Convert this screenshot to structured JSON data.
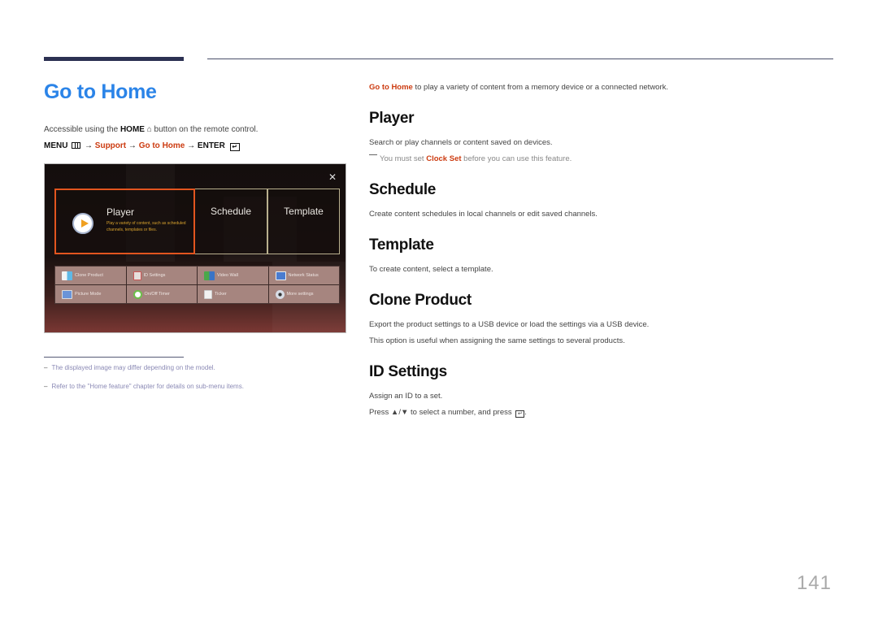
{
  "header": {
    "title": "Go to Home"
  },
  "left": {
    "access_prefix": "Accessible using the ",
    "access_key": "HOME",
    "access_icon": "home-icon",
    "access_suffix": " button on the remote control.",
    "menu_path": {
      "menu": "MENU",
      "arrow": "→",
      "support": "Support",
      "go_to_home": "Go to Home",
      "enter": "ENTER",
      "enter_glyph": "↵"
    },
    "tv_ui": {
      "close_glyph": "✕",
      "tiles": [
        {
          "title": "Player",
          "description": "Play a variety of content, such as scheduled channels, templates or files.",
          "selected": true
        },
        {
          "title": "Schedule",
          "selected": false
        },
        {
          "title": "Template",
          "selected": false
        }
      ],
      "menu_items": [
        {
          "label": "Clone Product",
          "icon": "clone-product-icon"
        },
        {
          "label": "ID Settings",
          "icon": "id-settings-icon"
        },
        {
          "label": "Video Wall",
          "icon": "video-wall-icon"
        },
        {
          "label": "Network Status",
          "icon": "network-status-icon"
        },
        {
          "label": "Picture Mode",
          "icon": "picture-mode-icon"
        },
        {
          "label": "On/Off Timer",
          "icon": "timer-icon"
        },
        {
          "label": "Ticker",
          "icon": "ticker-icon"
        },
        {
          "label": "More settings",
          "icon": "more-settings-icon"
        }
      ]
    },
    "footnotes": [
      "The displayed image may differ depending on the model.",
      "Refer to the \"Home feature\" chapter for details on sub-menu items."
    ]
  },
  "right": {
    "intro_highlight": "Go to Home",
    "intro_text": " to play a variety of content from a memory device or a connected network.",
    "sections": {
      "player": {
        "heading": "Player",
        "text": "Search or play channels or content saved on devices.",
        "note_prefix": "You must set ",
        "note_highlight": "Clock Set",
        "note_suffix": " before you can use this feature."
      },
      "schedule": {
        "heading": "Schedule",
        "text": "Create content schedules in local channels or edit saved channels."
      },
      "template": {
        "heading": "Template",
        "text": "To create content, select a template."
      },
      "clone_product": {
        "heading": "Clone Product",
        "text1": "Export the product settings to a USB device or load the settings via a USB device.",
        "text2": "This option is useful when assigning the same settings to several products."
      },
      "id_settings": {
        "heading": "ID Settings",
        "text1": "Assign an ID to a set.",
        "text2_prefix": "Press ▲/▼ to select a number, and press ",
        "text2_suffix": "."
      }
    }
  },
  "footer": {
    "page_number": "141"
  },
  "colors": {
    "title_blue": "#2b84e8",
    "highlight_red": "#cc3b10",
    "selected_tile_orange": "#e2551f"
  }
}
